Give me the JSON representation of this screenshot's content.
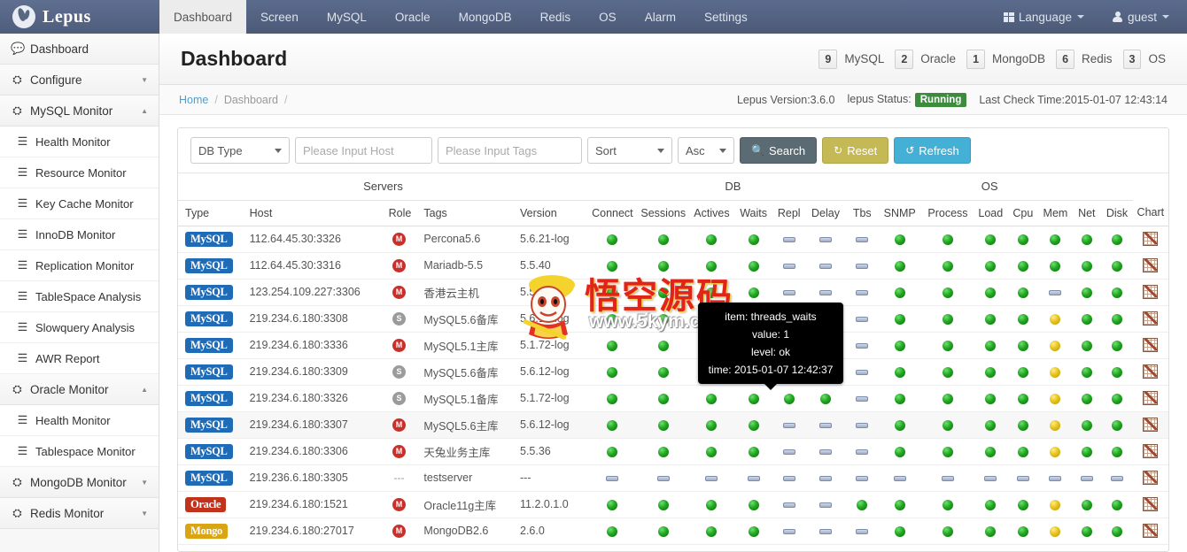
{
  "navbar": {
    "brand": "Lepus",
    "brand_logo_icon": "rabbit-logo-icon",
    "links": [
      {
        "label": "Dashboard",
        "active": true
      },
      {
        "label": "Screen",
        "active": false
      },
      {
        "label": "MySQL",
        "active": false
      },
      {
        "label": "Oracle",
        "active": false
      },
      {
        "label": "MongoDB",
        "active": false
      },
      {
        "label": "Redis",
        "active": false
      },
      {
        "label": "OS",
        "active": false
      },
      {
        "label": "Alarm",
        "active": false
      },
      {
        "label": "Settings",
        "active": false
      }
    ],
    "language": "Language",
    "user": "guest"
  },
  "sidebar": {
    "items": [
      {
        "label": "Dashboard",
        "icon": "comment-icon",
        "type": "top",
        "chev": ""
      },
      {
        "label": "Configure",
        "icon": "gauge-icon",
        "type": "top",
        "chev": "⌄"
      },
      {
        "label": "MySQL Monitor",
        "icon": "gauge-icon",
        "type": "top",
        "chev": "⌃"
      },
      {
        "label": "Health Monitor",
        "icon": "list-icon",
        "type": "sub",
        "chev": ""
      },
      {
        "label": "Resource Monitor",
        "icon": "list-icon",
        "type": "sub",
        "chev": ""
      },
      {
        "label": "Key Cache Monitor",
        "icon": "list-icon",
        "type": "sub",
        "chev": ""
      },
      {
        "label": "InnoDB Monitor",
        "icon": "list-icon",
        "type": "sub",
        "chev": ""
      },
      {
        "label": "Replication Monitor",
        "icon": "list-icon",
        "type": "sub",
        "chev": ""
      },
      {
        "label": "TableSpace Analysis",
        "icon": "list-icon",
        "type": "sub",
        "chev": ""
      },
      {
        "label": "Slowquery Analysis",
        "icon": "list-icon",
        "type": "sub",
        "chev": ""
      },
      {
        "label": "AWR Report",
        "icon": "list-icon",
        "type": "sub",
        "chev": ""
      },
      {
        "label": "Oracle Monitor",
        "icon": "gauge-icon",
        "type": "top",
        "chev": "⌃"
      },
      {
        "label": "Health Monitor",
        "icon": "list-icon",
        "type": "sub",
        "chev": ""
      },
      {
        "label": "Tablespace Monitor",
        "icon": "list-icon",
        "type": "sub",
        "chev": ""
      },
      {
        "label": "MongoDB Monitor",
        "icon": "gauge-icon",
        "type": "top",
        "chev": "⌄"
      },
      {
        "label": "Redis Monitor",
        "icon": "gauge-icon",
        "type": "top",
        "chev": "⌄"
      }
    ]
  },
  "page": {
    "title": "Dashboard",
    "counts": [
      {
        "value": "9",
        "label": "MySQL"
      },
      {
        "value": "2",
        "label": "Oracle"
      },
      {
        "value": "1",
        "label": "MongoDB"
      },
      {
        "value": "6",
        "label": "Redis"
      },
      {
        "value": "3",
        "label": "OS"
      }
    ],
    "breadcrumb": {
      "home": "Home",
      "sep1": "/",
      "current": "Dashboard",
      "sep2": "/"
    },
    "version_text": "Lepus Version:3.6.0",
    "status_label": "lepus Status:",
    "status_value": "Running",
    "status_color": "#3d8b3d",
    "last_check": "Last Check Time:2015-01-07 12:43:14"
  },
  "toolbar": {
    "db_type": "DB Type",
    "host_placeholder": "Please Input Host",
    "host_value": "",
    "tags_placeholder": "Please Input Tags",
    "tags_value": "",
    "sort": "Sort",
    "order": "Asc",
    "search_label": "Search",
    "reset_label": "Reset",
    "refresh_label": "Refresh",
    "search_icon": "magnifier-icon",
    "reset_icon": "refresh-ccw-icon",
    "refresh_icon": "refresh-cw-icon"
  },
  "table": {
    "groups": [
      {
        "label": "Servers",
        "span": 5
      },
      {
        "label": "DB",
        "span": 7
      },
      {
        "label": "OS",
        "span": 6
      },
      {
        "label": "",
        "span": 1
      }
    ],
    "columns": [
      "Type",
      "Host",
      "Role",
      "Tags",
      "Version",
      "Connect",
      "Sessions",
      "Actives",
      "Waits",
      "Repl",
      "Delay",
      "Tbs",
      "SNMP",
      "Process",
      "Load",
      "Cpu",
      "Mem",
      "Net",
      "Disk",
      "Chart"
    ],
    "rows": [
      {
        "type": "MySQL",
        "type_style": "mysql",
        "host": "112.64.45.30:3326",
        "role": "M",
        "tags": "Percona5.6",
        "version": "5.6.21-log",
        "states": [
          "green",
          "green",
          "green",
          "green",
          "bar",
          "bar",
          "bar",
          "green",
          "green",
          "green",
          "green",
          "green",
          "green",
          "green"
        ],
        "chart": "chart-icon"
      },
      {
        "type": "MySQL",
        "type_style": "mysql",
        "host": "112.64.45.30:3316",
        "role": "M",
        "tags": "Mariadb-5.5",
        "version": "5.5.40",
        "states": [
          "green",
          "green",
          "green",
          "green",
          "bar",
          "bar",
          "bar",
          "green",
          "green",
          "green",
          "green",
          "green",
          "green",
          "green"
        ],
        "chart": "chart-icon"
      },
      {
        "type": "MySQL",
        "type_style": "mysql",
        "host": "123.254.109.227:3306",
        "role": "M",
        "tags": "香港云主机",
        "version": "5.5.36",
        "states": [
          "green",
          "green",
          "green",
          "green",
          "bar",
          "bar",
          "bar",
          "green",
          "green",
          "green",
          "green",
          "bar",
          "green",
          "green"
        ],
        "chart": "chart-icon"
      },
      {
        "type": "MySQL",
        "type_style": "mysql",
        "host": "219.234.6.180:3308",
        "role": "S",
        "tags": "MySQL5.6备库",
        "version": "5.6.12-log",
        "states": [
          "green",
          "green",
          "green",
          "green",
          "green",
          "green",
          "bar",
          "green",
          "green",
          "green",
          "green",
          "yellow",
          "green",
          "green"
        ],
        "chart": "chart-icon"
      },
      {
        "type": "MySQL",
        "type_style": "mysql",
        "host": "219.234.6.180:3336",
        "role": "M",
        "tags": "MySQL5.1主库",
        "version": "5.1.72-log",
        "states": [
          "green",
          "green",
          "green",
          "green",
          "bar",
          "bar",
          "bar",
          "green",
          "green",
          "green",
          "green",
          "yellow",
          "green",
          "green"
        ],
        "chart": "chart-icon"
      },
      {
        "type": "MySQL",
        "type_style": "mysql",
        "host": "219.234.6.180:3309",
        "role": "S",
        "tags": "MySQL5.6备库",
        "version": "5.6.12-log",
        "states": [
          "green",
          "green",
          "green",
          "green",
          "green",
          "green",
          "bar",
          "green",
          "green",
          "green",
          "green",
          "yellow",
          "green",
          "green"
        ],
        "chart": "chart-icon"
      },
      {
        "type": "MySQL",
        "type_style": "mysql",
        "host": "219.234.6.180:3326",
        "role": "S",
        "tags": "MySQL5.1备库",
        "version": "5.1.72-log",
        "states": [
          "green",
          "green",
          "green",
          "green",
          "green",
          "green",
          "bar",
          "green",
          "green",
          "green",
          "green",
          "yellow",
          "green",
          "green"
        ],
        "chart": "chart-icon"
      },
      {
        "type": "MySQL",
        "type_style": "mysql",
        "host": "219.234.6.180:3307",
        "role": "M",
        "tags": "MySQL5.6主库",
        "version": "5.6.12-log",
        "alt": true,
        "states": [
          "green",
          "green",
          "green",
          "green",
          "bar",
          "bar",
          "bar",
          "green",
          "green",
          "green",
          "green",
          "yellow",
          "green",
          "green"
        ],
        "chart": "chart-icon"
      },
      {
        "type": "MySQL",
        "type_style": "mysql",
        "host": "219.234.6.180:3306",
        "role": "M",
        "tags": "天兔业务主库",
        "version": "5.5.36",
        "states": [
          "green",
          "green",
          "green",
          "green",
          "bar",
          "bar",
          "bar",
          "green",
          "green",
          "green",
          "green",
          "yellow",
          "green",
          "green"
        ],
        "chart": "chart-icon"
      },
      {
        "type": "MySQL",
        "type_style": "mysql",
        "host": "219.236.6.180:3305",
        "role": "-",
        "tags": "testserver",
        "version": "---",
        "states": [
          "bar",
          "bar",
          "bar",
          "bar",
          "bar",
          "bar",
          "bar",
          "bar",
          "bar",
          "bar",
          "bar",
          "bar",
          "bar",
          "bar"
        ],
        "chart": "chart-icon"
      },
      {
        "type": "Oracle",
        "type_style": "oracle",
        "host": "219.234.6.180:1521",
        "role": "M",
        "tags": "Oracle11g主库",
        "version": "11.2.0.1.0",
        "states": [
          "green",
          "green",
          "green",
          "green",
          "bar",
          "bar",
          "green",
          "green",
          "green",
          "green",
          "green",
          "yellow",
          "green",
          "green"
        ],
        "chart": "chart-icon"
      },
      {
        "type": "Mongo",
        "type_style": "mongo",
        "host": "219.234.6.180:27017",
        "role": "M",
        "tags": "MongoDB2.6",
        "version": "2.6.0",
        "states": [
          "green",
          "green",
          "green",
          "green",
          "bar",
          "bar",
          "bar",
          "green",
          "green",
          "green",
          "green",
          "yellow",
          "green",
          "green"
        ],
        "chart": "chart-icon"
      }
    ]
  },
  "tooltip": {
    "item": "item: threads_waits",
    "value": "value: 1",
    "level": "level: ok",
    "time": "time: 2015-01-07 12:42:37"
  },
  "watermark": {
    "text": "悟空源码",
    "url": "www.5kym.com"
  }
}
